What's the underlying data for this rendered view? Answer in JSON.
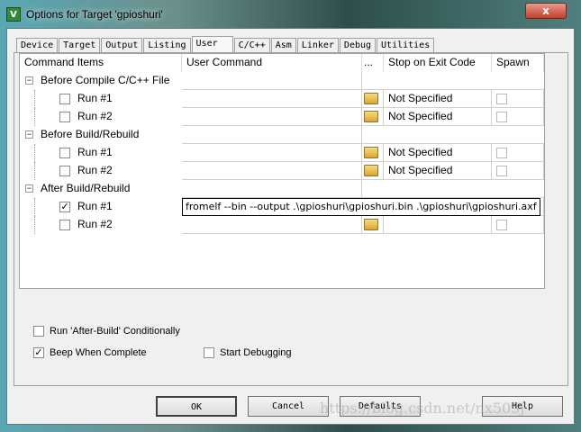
{
  "window": {
    "title": "Options for Target 'gpioshuri'",
    "close": "x",
    "app_icon": "V"
  },
  "tabs": [
    "Device",
    "Target",
    "Output",
    "Listing",
    "User",
    "C/C++",
    "Asm",
    "Linker",
    "Debug",
    "Utilities"
  ],
  "table": {
    "headers": [
      "Command Items",
      "User Command",
      "...",
      "Stop on Exit Code",
      "Spawn"
    ],
    "groups": [
      {
        "label": "Before Compile C/C++ File",
        "items": [
          {
            "label": "Run #1",
            "checked": false,
            "command": "",
            "stop": "Not Specified"
          },
          {
            "label": "Run #2",
            "checked": false,
            "command": "",
            "stop": "Not Specified"
          }
        ]
      },
      {
        "label": "Before Build/Rebuild",
        "items": [
          {
            "label": "Run #1",
            "checked": false,
            "command": "",
            "stop": "Not Specified"
          },
          {
            "label": "Run #2",
            "checked": false,
            "command": "",
            "stop": "Not Specified"
          }
        ]
      },
      {
        "label": "After Build/Rebuild",
        "items": [
          {
            "label": "Run #1",
            "checked": true,
            "command": "fromelf --bin --output .\\gpioshuri\\gpioshuri.bin .\\gpioshuri\\gpioshuri.axf",
            "stop": ""
          },
          {
            "label": "Run #2",
            "checked": false,
            "command": "",
            "stop": ""
          }
        ]
      }
    ]
  },
  "options": {
    "run_after_build": "Run 'After-Build' Conditionally",
    "beep": "Beep When Complete",
    "start_debugging": "Start Debugging",
    "beep_checked": true
  },
  "buttons": {
    "ok": "OK",
    "cancel": "Cancel",
    "defaults": "Defaults",
    "help": "Help"
  },
  "watermark": "https://blog.csdn.net/nx505j"
}
